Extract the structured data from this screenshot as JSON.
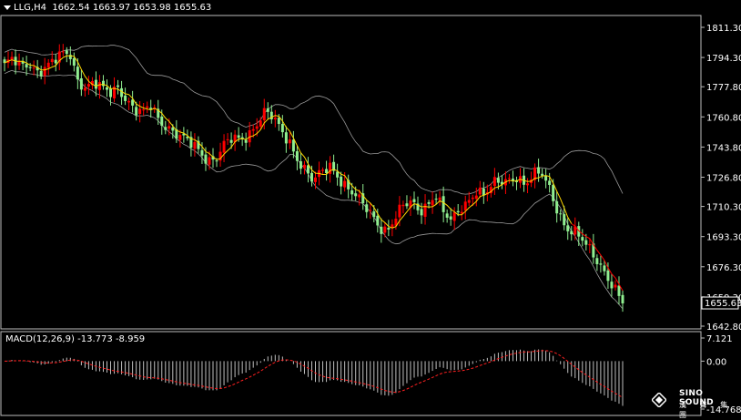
{
  "header": {
    "symbol": "LLG,H4",
    "ohlc": "1662.54 1663.97 1653.98 1655.63"
  },
  "macd_header": {
    "label": "MACD(12,26,9)",
    "macd": "-13.773",
    "signal": "-8.959"
  },
  "price_axis_labels": [
    "1811.30",
    "1794.30",
    "1777.80",
    "1760.80",
    "1743.80",
    "1726.80",
    "1710.30",
    "1693.30",
    "1676.30",
    "1659.30",
    "1642.80"
  ],
  "current_price": "1655.63",
  "macd_axis_labels": [
    "7.121",
    "0.00",
    "-14.768"
  ],
  "watermark": {
    "brand": "SINO SOUND",
    "sub": "漢 聲 集 團"
  },
  "colors": {
    "up": "#ff0000",
    "down": "#90ee90",
    "ma": "#ffd700",
    "bands": "#c0c0c0",
    "signal": "#ff2020",
    "histogram": "#c0c0c0"
  },
  "chart_data": [
    {
      "type": "candlestick",
      "title": "LLG,H4",
      "indicators": [
        "Bollinger Bands",
        "Moving Average"
      ],
      "ylim": [
        1642.8,
        1815.0
      ],
      "yticks": [
        1811.3,
        1794.3,
        1777.8,
        1760.8,
        1743.8,
        1726.8,
        1710.3,
        1693.3,
        1676.3,
        1659.3,
        1642.8
      ],
      "close_path": [
        1790,
        1793,
        1788,
        1791,
        1787,
        1789,
        1792,
        1795,
        1797,
        1782,
        1778,
        1780,
        1776,
        1774,
        1778,
        1771,
        1765,
        1762,
        1767,
        1759,
        1756,
        1752,
        1748,
        1745,
        1741,
        1737,
        1738,
        1745,
        1748,
        1747,
        1751,
        1758,
        1764,
        1760,
        1752,
        1747,
        1738,
        1731,
        1724,
        1729,
        1733,
        1728,
        1722,
        1717,
        1711,
        1706,
        1700,
        1697,
        1704,
        1710,
        1712,
        1708,
        1712,
        1718,
        1706,
        1701,
        1709,
        1714,
        1720,
        1716,
        1722,
        1724,
        1726,
        1728,
        1722,
        1727,
        1729,
        1721,
        1709,
        1698,
        1695,
        1691,
        1686,
        1680,
        1672,
        1663,
        1655.63
      ]
    },
    {
      "type": "line",
      "title": "MACD(12,26,9)",
      "ylim": [
        -14.768,
        7.121
      ],
      "series": [
        {
          "name": "MACD",
          "last": -13.773
        },
        {
          "name": "Signal",
          "last": -8.959
        }
      ]
    }
  ]
}
